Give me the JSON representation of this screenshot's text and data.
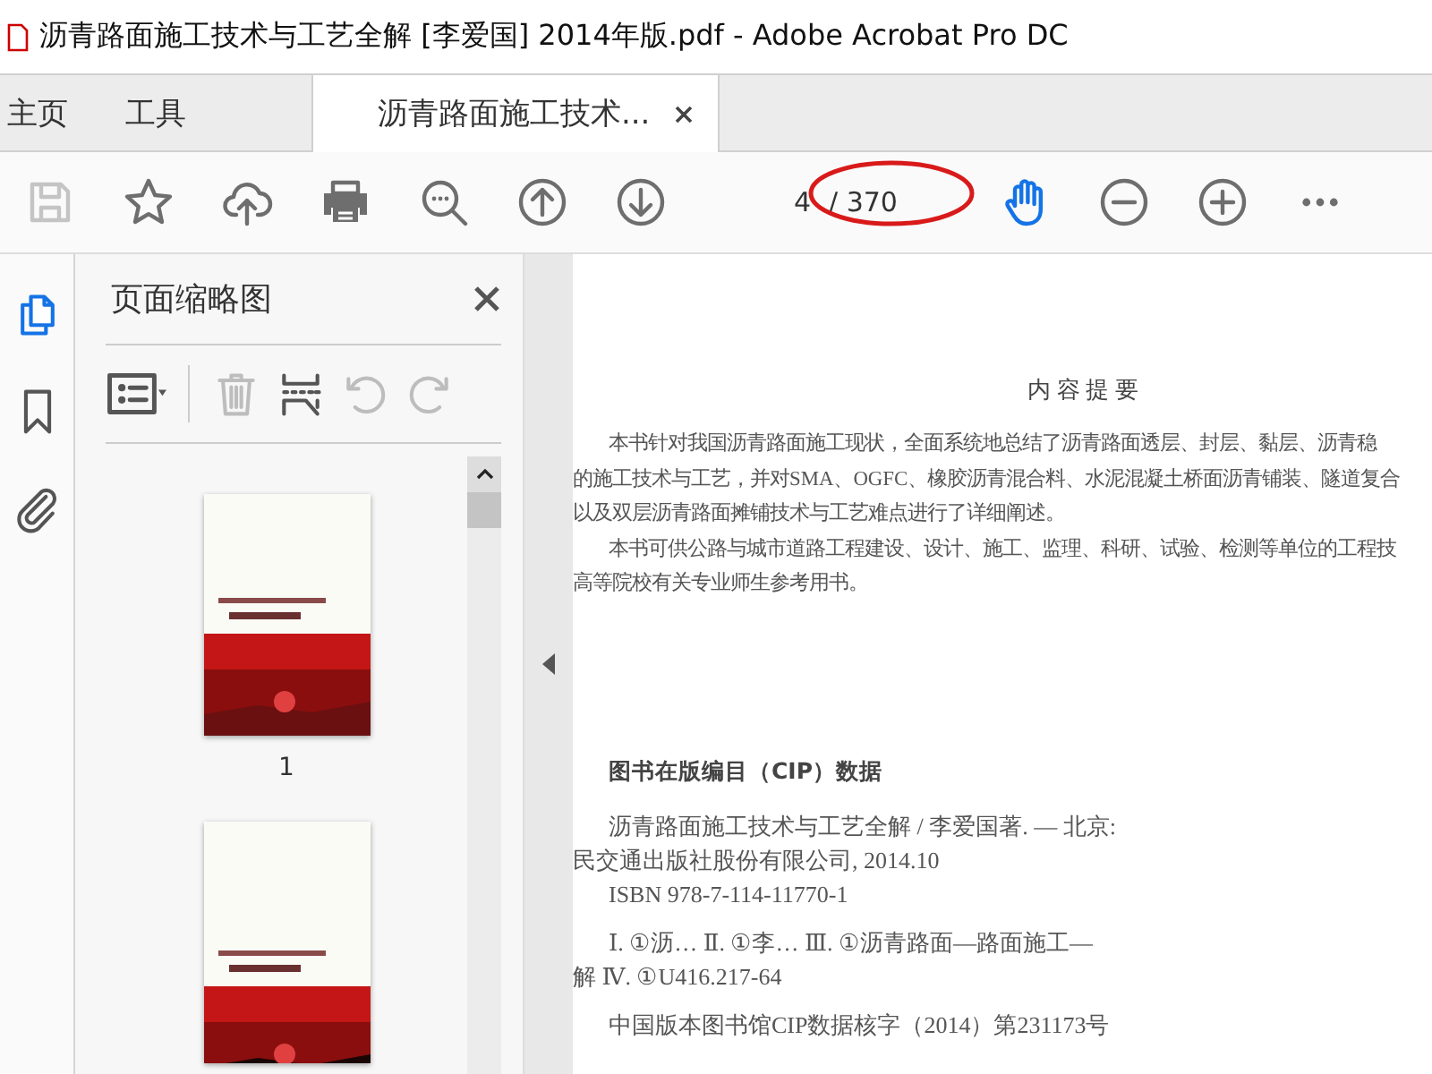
{
  "window": {
    "title": "沥青路面施工技术与工艺全解 [李爱国] 2014年版.pdf - Adobe Acrobat Pro DC"
  },
  "tabs": [
    {
      "label": "主页",
      "selected": false,
      "closable": false
    },
    {
      "label": "工具",
      "selected": false,
      "closable": false
    },
    {
      "label": "沥青路面施工技术...",
      "selected": true,
      "closable": true
    }
  ],
  "toolbar": {
    "tools": [
      {
        "kind": "save",
        "disabled": true,
        "selected": false
      },
      {
        "kind": "star",
        "disabled": false,
        "selected": false
      },
      {
        "kind": "upload",
        "disabled": false,
        "selected": false
      },
      {
        "kind": "print",
        "disabled": false,
        "selected": false
      },
      {
        "kind": "zoom",
        "disabled": false,
        "selected": false
      },
      {
        "kind": "prev",
        "disabled": false,
        "selected": false
      },
      {
        "kind": "next",
        "disabled": false,
        "selected": false
      },
      {
        "kind": "page"
      },
      {
        "kind": "hand",
        "disabled": false,
        "selected": true
      },
      {
        "kind": "zoomout",
        "disabled": false,
        "selected": false
      },
      {
        "kind": "zoomin",
        "disabled": false,
        "selected": false
      },
      {
        "kind": "more",
        "disabled": false,
        "selected": false
      }
    ],
    "page_field": {
      "value": "4",
      "total": "/ 370"
    }
  },
  "rail": [
    {
      "kind": "pages",
      "selected": true
    },
    {
      "kind": "bookmarks",
      "selected": false
    },
    {
      "kind": "attachments",
      "selected": false
    }
  ],
  "panel": {
    "title": "页面缩略图",
    "tools": [
      {
        "kind": "options",
        "disabled": false
      },
      {
        "kind": "delete",
        "disabled": true
      },
      {
        "kind": "insert",
        "disabled": false
      },
      {
        "kind": "undo",
        "disabled": true
      },
      {
        "kind": "redo",
        "disabled": true
      }
    ],
    "thumbnails": [
      {
        "kind": "picture",
        "label": "1"
      },
      {
        "kind": "picture"
      }
    ]
  },
  "document": {
    "heading": "内 容 提 要",
    "summary": [
      {
        "text": "本书针对我国沥青路面施工现状，全面系统地总结了沥青路面透层、封层、黏层、沥青稳",
        "indent": true
      },
      {
        "text": "的施工技术与工艺，并对SMA、OGFC、橡胶沥青混合料、水泥混凝土桥面沥青铺装、隧道复合",
        "indent": false
      },
      {
        "text": "以及双层沥青路面摊铺技术与工艺难点进行了详细阐述。",
        "indent": false
      },
      {
        "text": "本书可供公路与城市道路工程建设、设计、施工、监理、科研、试验、检测等单位的工程技",
        "indent": true
      },
      {
        "text": "高等院校有关专业师生参考用书。",
        "indent": false
      }
    ],
    "cip_heading": "图书在版编目（CIP）数据",
    "cip": [
      {
        "lines": [
          {
            "text": "沥青路面施工技术与工艺全解 / 李爱国著. — 北京:",
            "indent": true
          },
          {
            "text": "民交通出版社股份有限公司, 2014.10",
            "indent": false
          },
          {
            "text": "ISBN 978-7-114-11770-1",
            "indent": true
          }
        ]
      },
      {
        "lines": [
          {
            "text": "Ⅰ. ①沥… Ⅱ. ①李… Ⅲ. ①沥青路面—路面施工—",
            "indent": true
          },
          {
            "text": "解 Ⅳ. ①U416.217-64",
            "indent": false
          }
        ]
      },
      {
        "lines": [
          {
            "text": "中国版本图书馆CIP数据核字（2014）第231173号",
            "indent": true
          }
        ]
      }
    ]
  }
}
